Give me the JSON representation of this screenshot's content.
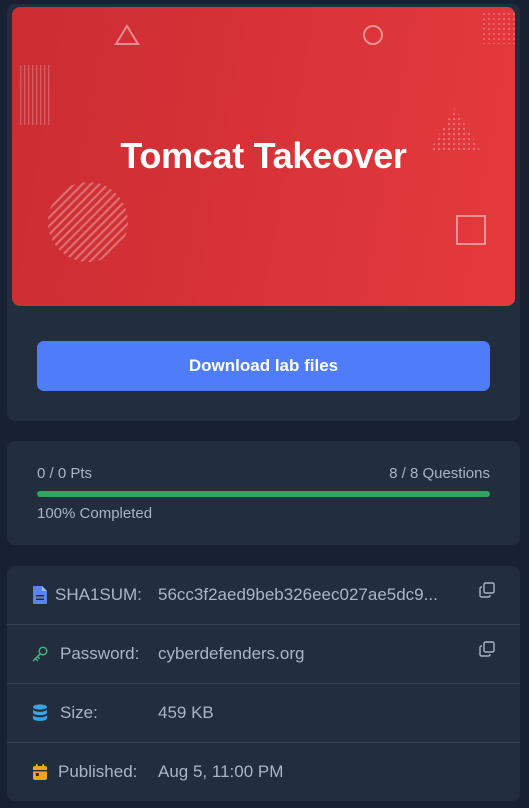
{
  "banner": {
    "title": "Tomcat Takeover",
    "colors": {
      "start": "#cb2d33",
      "end": "#e53a3d"
    }
  },
  "download_button": {
    "label": "Download lab files",
    "color": "#4f7dfa"
  },
  "progress": {
    "points": "0 / 0 Pts",
    "questions": "8 / 8 Questions",
    "percent": 100,
    "completed_label": "100% Completed",
    "color": "#2fa55f"
  },
  "info": {
    "sha1": {
      "label": "SHA1SUM:",
      "value": "56cc3f2aed9beb326eec027ae5dc9...",
      "icon": "file-icon"
    },
    "password": {
      "label": "Password:",
      "value": "cyberdefenders.org",
      "icon": "key-icon"
    },
    "size": {
      "label": "Size:",
      "value": "459 KB",
      "icon": "database-icon"
    },
    "published": {
      "label": "Published:",
      "value": "Aug 5, 11:00 PM",
      "icon": "calendar-icon"
    }
  }
}
